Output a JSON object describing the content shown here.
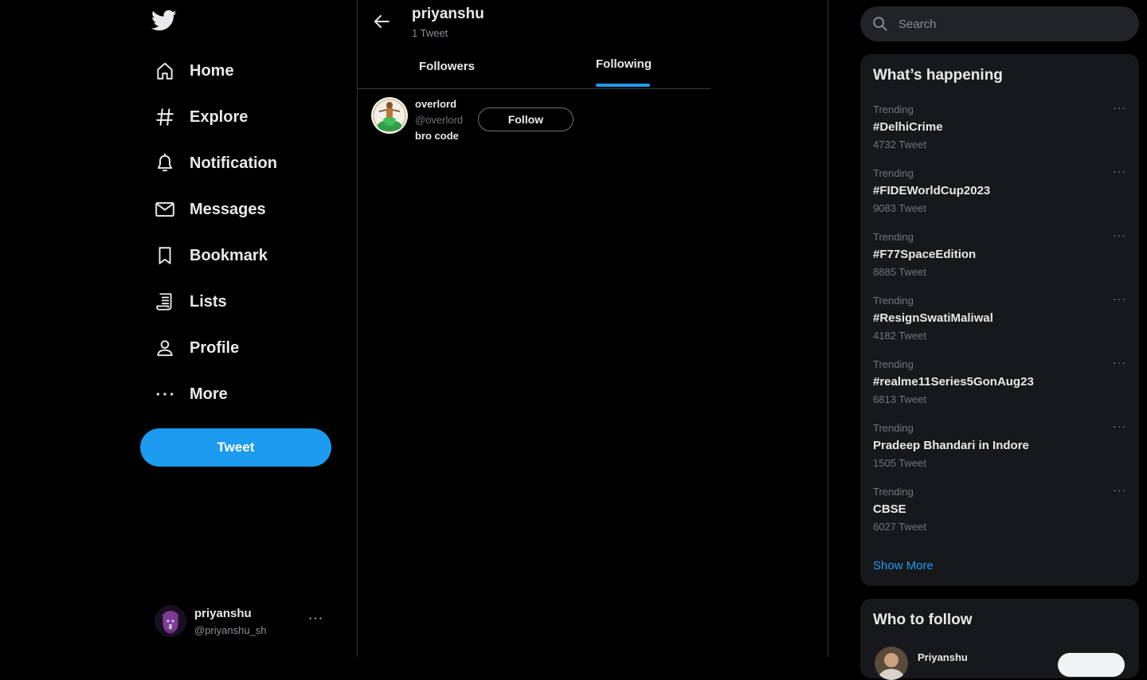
{
  "sidebar": {
    "logo_icon": "twitter-bird-icon",
    "items": [
      {
        "label": "Home",
        "icon": "home-icon"
      },
      {
        "label": "Explore",
        "icon": "hashtag-icon"
      },
      {
        "label": "Notification",
        "icon": "bell-icon"
      },
      {
        "label": "Messages",
        "icon": "envelope-icon"
      },
      {
        "label": "Bookmark",
        "icon": "bookmark-icon"
      },
      {
        "label": "Lists",
        "icon": "list-icon"
      },
      {
        "label": "Profile",
        "icon": "person-icon"
      },
      {
        "label": "More",
        "icon": "more-dots-icon"
      }
    ],
    "tweet_button": "Tweet",
    "account": {
      "name": "priyanshu",
      "handle": "@priyanshu_sh",
      "more": "···"
    }
  },
  "header": {
    "title": "priyanshu",
    "subtitle": "1 Tweet"
  },
  "tabs": [
    {
      "label": "Followers",
      "active": false
    },
    {
      "label": "Following",
      "active": true
    }
  ],
  "following": [
    {
      "name": "overlord",
      "handle": "@overlord",
      "bio": "bro code",
      "button": "Follow"
    }
  ],
  "search": {
    "placeholder": "Search"
  },
  "trends": {
    "title": "What’s happening",
    "items": [
      {
        "label": "Trending",
        "name": "#DelhiCrime",
        "count": "4732 Tweet"
      },
      {
        "label": "Trending",
        "name": "#FIDEWorldCup2023",
        "count": "9083 Tweet"
      },
      {
        "label": "Trending",
        "name": "#F77SpaceEdition",
        "count": "8885 Tweet"
      },
      {
        "label": "Trending",
        "name": "#ResignSwatiMaliwal",
        "count": "4182 Tweet"
      },
      {
        "label": "Trending",
        "name": "#realme11Series5GonAug23",
        "count": "6813 Tweet"
      },
      {
        "label": "Trending",
        "name": "Pradeep Bhandari in Indore",
        "count": "1505 Tweet"
      },
      {
        "label": "Trending",
        "name": "CBSE",
        "count": "6027 Tweet"
      }
    ],
    "more_icon": "···",
    "show_more": "Show More"
  },
  "who_to_follow": {
    "title": "Who to follow",
    "first_name": "Priyanshu"
  },
  "colors": {
    "accent": "#1d9bf0",
    "background": "#000000",
    "panel": "#16181c",
    "muted_text": "#71767b"
  }
}
